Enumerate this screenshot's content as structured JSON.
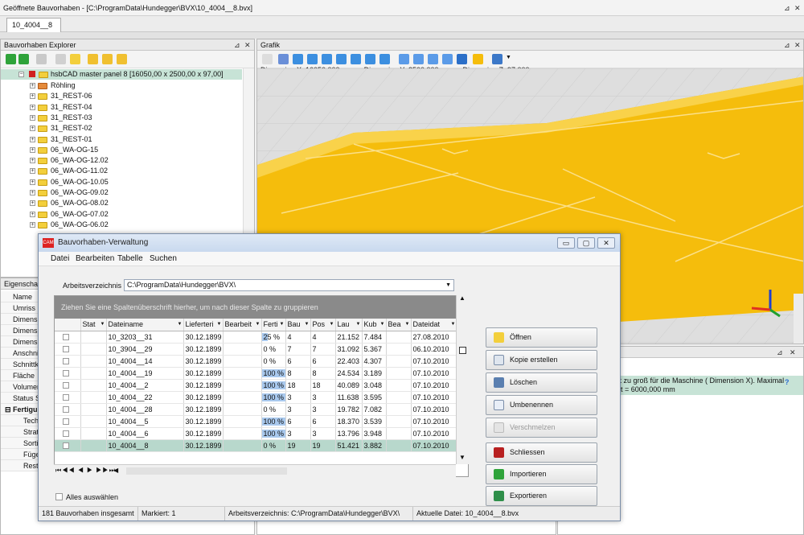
{
  "topbar": {
    "title": "Geöffnete Bauvorhaben  -  [C:\\ProgramData\\Hundegger\\BVX\\10_4004__8.bvx]",
    "tab": "10_4004__8"
  },
  "explorer": {
    "title": "Bauvorhaben Explorer",
    "root": "hsbCAD master panel 8 [16050,00 x 2500,00 x 97,00]",
    "items": [
      "Röhling",
      "31_REST-06",
      "31_REST-04",
      "31_REST-03",
      "31_REST-02",
      "31_REST-01",
      "06_WA-OG-15",
      "06_WA-OG-12.02",
      "06_WA-OG-11.02",
      "06_WA-OG-10.05",
      "06_WA-OG-09.02",
      "06_WA-OG-08.02",
      "06_WA-OG-07.02",
      "06_WA-OG-06.02"
    ]
  },
  "props": {
    "title": "Eigenschaf",
    "rows": [
      "Name",
      "Umriss",
      "Dimensi",
      "Dimensi",
      "Dimensi",
      "Anschni",
      "Schnittk",
      "Fläche",
      "Volumen",
      "Status S"
    ],
    "section": "Fertigu",
    "subrows": [
      "Tech",
      "Strat",
      "Sorti",
      "Füge",
      "Rest"
    ]
  },
  "grafik": {
    "title": "Grafik",
    "dimx": "Dimension X:  16050,000 mm",
    "dimy": "Dimension Y:  2500,000 mm",
    "dimz": "Dimension Z:  97,000 mm",
    "accent": "#f5bd0c"
  },
  "lower_right": {
    "line1": "ist zu groß für die Maschine ( Dimension X). Maximal",
    "line2": "ert = 6000,000 mm",
    "help": "?"
  },
  "dialog": {
    "title": "Bauvorhaben-Verwaltung",
    "menu": [
      "Datei",
      "Bearbeiten",
      "Tabelle",
      "Suchen"
    ],
    "workdir_label": "Arbeitsverzeichnis",
    "workdir_value": "C:\\ProgramData\\Hundegger\\BVX\\",
    "group_hint": "Ziehen Sie eine Spaltenüberschrift hierher, um nach dieser Spalte zu gruppieren",
    "columns": [
      "",
      "Stat",
      "Dateiname",
      "Lieferteri",
      "Bearbeit",
      "Ferti",
      "Bau",
      "Pos",
      "Lau",
      "Kub",
      "Bea",
      "Dateidat"
    ],
    "rows": [
      {
        "name": "10_3203__31",
        "date": "30.12.1899",
        "fert": "25 %",
        "pct": 25,
        "bau": "4",
        "pos": "4",
        "lau": "21.152",
        "kub": "7.484",
        "dd": "27.08.2010"
      },
      {
        "name": "10_3904__29",
        "date": "30.12.1899",
        "fert": "0 %",
        "pct": 0,
        "bau": "7",
        "pos": "7",
        "lau": "31.092",
        "kub": "5.367",
        "dd": "06.10.2010"
      },
      {
        "name": "10_4004__14",
        "date": "30.12.1899",
        "fert": "0 %",
        "pct": 0,
        "bau": "6",
        "pos": "6",
        "lau": "22.403",
        "kub": "4.307",
        "dd": "07.10.2010"
      },
      {
        "name": "10_4004__19",
        "date": "30.12.1899",
        "fert": "100 %",
        "pct": 100,
        "bau": "8",
        "pos": "8",
        "lau": "24.534",
        "kub": "3.189",
        "dd": "07.10.2010"
      },
      {
        "name": "10_4004__2",
        "date": "30.12.1899",
        "fert": "100 %",
        "pct": 100,
        "bau": "18",
        "pos": "18",
        "lau": "40.089",
        "kub": "3.048",
        "dd": "07.10.2010"
      },
      {
        "name": "10_4004__22",
        "date": "30.12.1899",
        "fert": "100 %",
        "pct": 100,
        "bau": "3",
        "pos": "3",
        "lau": "11.638",
        "kub": "3.595",
        "dd": "07.10.2010"
      },
      {
        "name": "10_4004__28",
        "date": "30.12.1899",
        "fert": "0 %",
        "pct": 0,
        "bau": "3",
        "pos": "3",
        "lau": "19.782",
        "kub": "7.082",
        "dd": "07.10.2010"
      },
      {
        "name": "10_4004__5",
        "date": "30.12.1899",
        "fert": "100 %",
        "pct": 100,
        "bau": "6",
        "pos": "6",
        "lau": "18.370",
        "kub": "3.539",
        "dd": "07.10.2010"
      },
      {
        "name": "10_4004__6",
        "date": "30.12.1899",
        "fert": "100 %",
        "pct": 100,
        "bau": "3",
        "pos": "3",
        "lau": "13.796",
        "kub": "3.948",
        "dd": "07.10.2010"
      },
      {
        "name": "10_4004__8",
        "date": "30.12.1899",
        "fert": "0 %",
        "pct": 0,
        "bau": "19",
        "pos": "19",
        "lau": "51.421",
        "kub": "3.882",
        "dd": "07.10.2010"
      }
    ],
    "select_all": "Alles auswählen",
    "buttons": [
      "Öffnen",
      "Kopie erstellen",
      "Löschen",
      "Umbenennen",
      "Verschmelzen",
      "Schliessen",
      "Importieren",
      "Exportieren"
    ],
    "status": {
      "total": "181 Bauvorhaben insgesamt",
      "marked": "Markiert: 1",
      "workdir": "Arbeitsverzeichnis:  C:\\ProgramData\\Hundegger\\BVX\\",
      "current": "Aktuelle Datei: 10_4004__8.bvx"
    }
  }
}
